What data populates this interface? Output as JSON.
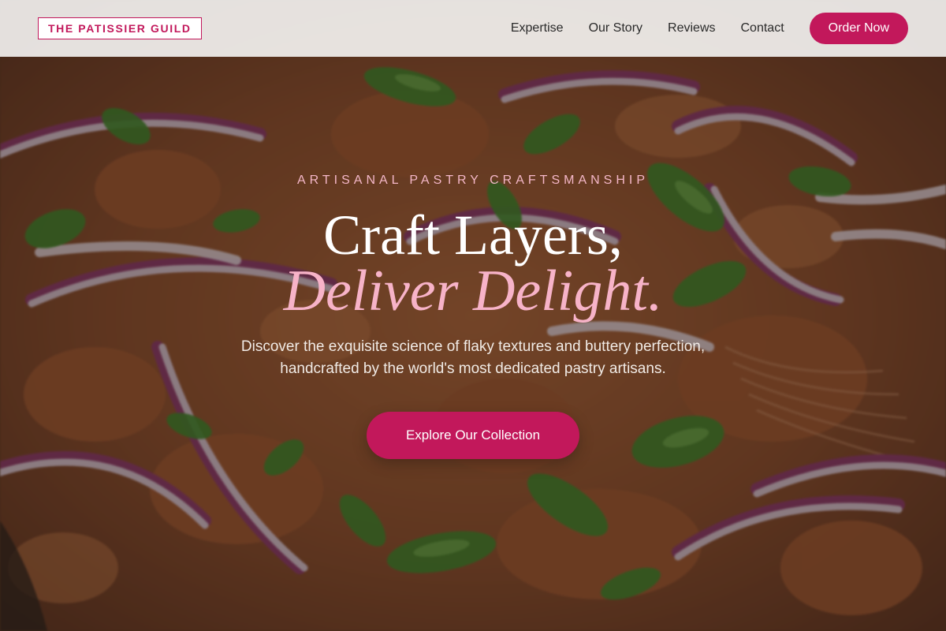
{
  "header": {
    "brand": "THE PATISSIER GUILD",
    "nav": [
      {
        "label": "Expertise"
      },
      {
        "label": "Our Story"
      },
      {
        "label": "Reviews"
      },
      {
        "label": "Contact"
      }
    ],
    "order_label": "Order Now"
  },
  "hero": {
    "eyebrow": "ARTISANAL PASTRY CRAFTSMANSHIP",
    "headline_line1": "Craft Layers,",
    "headline_line2": "Deliver Delight.",
    "subtitle_line1": "Discover the exquisite science of flaky textures and buttery perfection,",
    "subtitle_line2": "handcrafted by the world's most dedicated pastry artisans.",
    "cta_label": "Explore Our Collection",
    "background_image": "food-photo-onion-scallion"
  },
  "colors": {
    "accent": "#c2185b",
    "eyebrow": "#f4b7c8",
    "headline_italic": "#f7b3c8"
  }
}
